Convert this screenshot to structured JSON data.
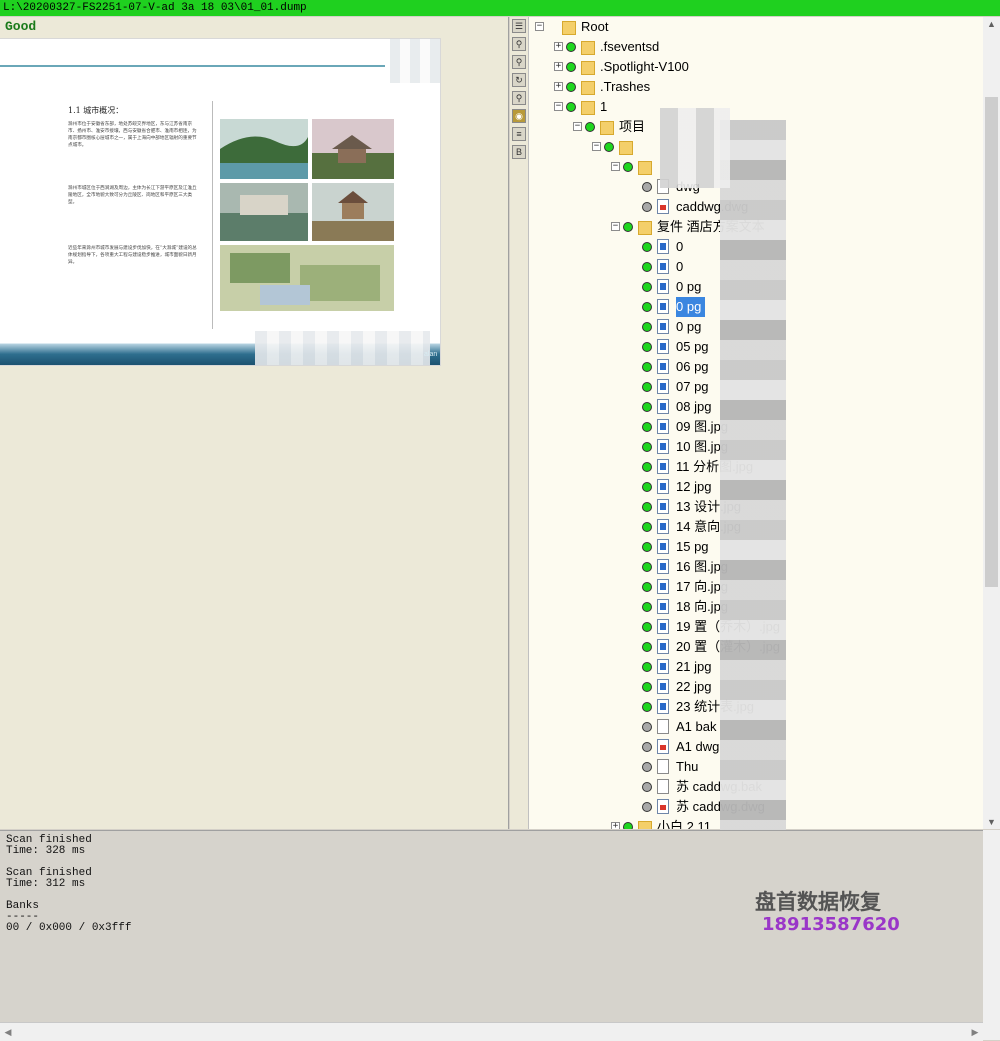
{
  "window": {
    "title": "L:\\20200327-FS2251-07-V-ad 3a 18 03\\01_01.dump"
  },
  "left_panel": {
    "status": "Good",
    "preview": {
      "heading": "1.1  城市概况：",
      "paragraph1": "滁州市位于安徽省东部，地处苏皖交界地区，东与江苏省南京市、扬州市、淮安市接壤，西与安徽省合肥市、淮南市相连，为南京都市圈核心层城市之一，属于上海向中部地区辐射的重要节点城市。",
      "paragraph2": "滁州市城区位于西涧湖及周边，主体为长江下游平原区及江淮丘陵地区，全市地貌大致可分为丘陵区、岗地区和平原区三大类型。",
      "paragraph3": "近些年来滁州市城市发展与建设步伐加快，在“大滁城”建设的总体规划指导下，各项重大工程与建设稳步推进，城市面貌日新月异。",
      "footer_text": "alan"
    }
  },
  "toolstrip": {
    "buttons": [
      {
        "name": "list-icon",
        "glyph": "☰"
      },
      {
        "name": "search-icon",
        "glyph": "⚲"
      },
      {
        "name": "search-alt-icon",
        "glyph": "⚲"
      },
      {
        "name": "refresh-icon",
        "glyph": "↻"
      },
      {
        "name": "find-icon",
        "glyph": "⚲"
      },
      {
        "name": "eye-icon",
        "glyph": "◉"
      },
      {
        "name": "text-icon",
        "glyph": "≡"
      },
      {
        "name": "bold-icon",
        "glyph": "B"
      }
    ]
  },
  "tree": {
    "rows": [
      {
        "label": "Root",
        "indent": 0,
        "exp": "−",
        "dot": "",
        "icon": "folder"
      },
      {
        "label": ".fseventsd",
        "indent": 1,
        "exp": "+",
        "dot": "g",
        "icon": "folder"
      },
      {
        "label": ".Spotlight-V100",
        "indent": 1,
        "exp": "+",
        "dot": "g",
        "icon": "folder"
      },
      {
        "label": ".Trashes",
        "indent": 1,
        "exp": "+",
        "dot": "g",
        "icon": "folder"
      },
      {
        "label": "1",
        "indent": 1,
        "exp": "−",
        "dot": "g",
        "icon": "folder"
      },
      {
        "label": "项目",
        "indent": 2,
        "exp": "−",
        "dot": "g",
        "icon": "folder"
      },
      {
        "label": "",
        "indent": 3,
        "exp": "−",
        "dot": "g",
        "icon": "folder"
      },
      {
        "label": "",
        "indent": 4,
        "exp": "−",
        "dot": "g",
        "icon": "folder"
      },
      {
        "label": "dwg",
        "indent": 5,
        "exp": "",
        "dot": "gy",
        "icon": "blank"
      },
      {
        "label": "caddwg.dwg",
        "indent": 5,
        "exp": "",
        "dot": "gy",
        "icon": "dwg"
      },
      {
        "label": "复件 酒店方案文本",
        "indent": 4,
        "exp": "−",
        "dot": "g",
        "icon": "folder"
      },
      {
        "label": "0",
        "indent": 5,
        "exp": "",
        "dot": "g",
        "icon": "img"
      },
      {
        "label": "0",
        "indent": 5,
        "exp": "",
        "dot": "g",
        "icon": "img"
      },
      {
        "label": "0 pg",
        "indent": 5,
        "exp": "",
        "dot": "g",
        "icon": "img"
      },
      {
        "label": "0 pg",
        "indent": 5,
        "exp": "",
        "dot": "g",
        "icon": "img",
        "selected": true
      },
      {
        "label": "0 pg",
        "indent": 5,
        "exp": "",
        "dot": "g",
        "icon": "img"
      },
      {
        "label": "05 pg",
        "indent": 5,
        "exp": "",
        "dot": "g",
        "icon": "img"
      },
      {
        "label": "06 pg",
        "indent": 5,
        "exp": "",
        "dot": "g",
        "icon": "img"
      },
      {
        "label": "07 pg",
        "indent": 5,
        "exp": "",
        "dot": "g",
        "icon": "img"
      },
      {
        "label": "08 jpg",
        "indent": 5,
        "exp": "",
        "dot": "g",
        "icon": "img"
      },
      {
        "label": "09 图.jpg",
        "indent": 5,
        "exp": "",
        "dot": "g",
        "icon": "img"
      },
      {
        "label": "10 图.jpg",
        "indent": 5,
        "exp": "",
        "dot": "g",
        "icon": "img"
      },
      {
        "label": "11 分析图.jpg",
        "indent": 5,
        "exp": "",
        "dot": "g",
        "icon": "img"
      },
      {
        "label": "12 jpg",
        "indent": 5,
        "exp": "",
        "dot": "g",
        "icon": "img"
      },
      {
        "label": "13 设计.jpg",
        "indent": 5,
        "exp": "",
        "dot": "g",
        "icon": "img"
      },
      {
        "label": "14 意向.jpg",
        "indent": 5,
        "exp": "",
        "dot": "g",
        "icon": "img"
      },
      {
        "label": "15 pg",
        "indent": 5,
        "exp": "",
        "dot": "g",
        "icon": "img"
      },
      {
        "label": "16 图.jpg",
        "indent": 5,
        "exp": "",
        "dot": "g",
        "icon": "img"
      },
      {
        "label": "17 向.jpg",
        "indent": 5,
        "exp": "",
        "dot": "g",
        "icon": "img"
      },
      {
        "label": "18 向.jpg",
        "indent": 5,
        "exp": "",
        "dot": "g",
        "icon": "img"
      },
      {
        "label": "19 置（乔木）.jpg",
        "indent": 5,
        "exp": "",
        "dot": "g",
        "icon": "img"
      },
      {
        "label": "20 置（灌木）.jpg",
        "indent": 5,
        "exp": "",
        "dot": "g",
        "icon": "img"
      },
      {
        "label": "21 jpg",
        "indent": 5,
        "exp": "",
        "dot": "g",
        "icon": "img"
      },
      {
        "label": "22 jpg",
        "indent": 5,
        "exp": "",
        "dot": "g",
        "icon": "img"
      },
      {
        "label": "23 统计表.jpg",
        "indent": 5,
        "exp": "",
        "dot": "g",
        "icon": "img"
      },
      {
        "label": "A1 bak",
        "indent": 5,
        "exp": "",
        "dot": "gy",
        "icon": "blank"
      },
      {
        "label": "A1 dwg",
        "indent": 5,
        "exp": "",
        "dot": "gy",
        "icon": "dwg"
      },
      {
        "label": "Thu",
        "indent": 5,
        "exp": "",
        "dot": "gy",
        "icon": "blank"
      },
      {
        "label": "苏 caddwg.bak",
        "indent": 5,
        "exp": "",
        "dot": "gy",
        "icon": "blank"
      },
      {
        "label": "苏 caddwg.dwg",
        "indent": 5,
        "exp": "",
        "dot": "gy",
        "icon": "dwg"
      },
      {
        "label": "小白 2.11",
        "indent": 4,
        "exp": "+",
        "dot": "g",
        "icon": "folder"
      }
    ]
  },
  "console": {
    "lines": "Scan finished\nTime: 328 ms\n\nScan finished\nTime: 312 ms\n\nBanks\n-----\n00 / 0x000 / 0x3fff"
  },
  "watermark": {
    "line1": "盘首数据恢复",
    "line2": "18913587620"
  }
}
